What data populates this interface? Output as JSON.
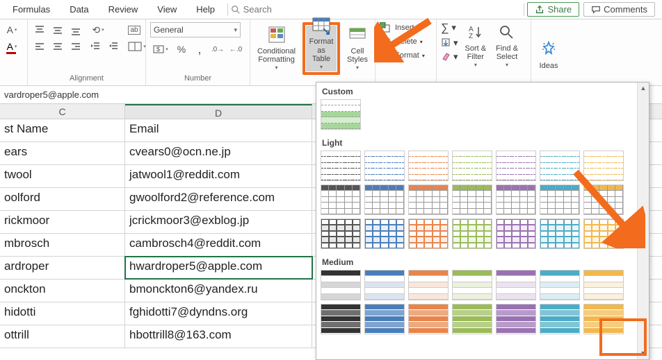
{
  "menu": {
    "tabs": [
      "Formulas",
      "Data",
      "Review",
      "View",
      "Help"
    ],
    "search_placeholder": "Search",
    "share": "Share",
    "comments": "Comments"
  },
  "ribbon": {
    "alignment_label": "Alignment",
    "number_label": "Number",
    "number_format": "General",
    "conditional": "Conditional\nFormatting",
    "format_table": "Format as\nTable",
    "cell_styles": "Cell\nStyles",
    "insert": "Insert",
    "delete": "Delete",
    "format": "Format",
    "sort_filter": "Sort &\nFilter",
    "find_select": "Find &\nSelect",
    "ideas": "Ideas"
  },
  "formula_bar": {
    "value": "vardroper5@apple.com"
  },
  "columns": {
    "C": "C",
    "D": "D"
  },
  "rows": [
    {
      "c": "st Name",
      "d": "Email"
    },
    {
      "c": "ears",
      "d": "cvears0@ocn.ne.jp"
    },
    {
      "c": "twool",
      "d": "jatwool1@reddit.com"
    },
    {
      "c": "oolford",
      "d": "gwoolford2@reference.com"
    },
    {
      "c": "rickmoor",
      "d": "jcrickmoor3@exblog.jp"
    },
    {
      "c": "mbrosch",
      "d": "cambrosch4@reddit.com"
    },
    {
      "c": "ardroper",
      "d": "hwardroper5@apple.com"
    },
    {
      "c": "onckton",
      "d": "bmonckton6@yandex.ru"
    },
    {
      "c": "hidotti",
      "d": "fghidotti7@dyndns.org"
    },
    {
      "c": "ottrill",
      "d": "hbottrill8@163.com"
    }
  ],
  "selected_row": 6,
  "dropdown": {
    "sections": [
      "Custom",
      "Light",
      "Medium"
    ],
    "light_colors": [
      "#555555",
      "#4a7ebb",
      "#e8854b",
      "#9bbb59",
      "#9a72b3",
      "#4bacc6",
      "#f2b84b"
    ],
    "medium_colors": [
      "#333333",
      "#4a7ebb",
      "#e8854b",
      "#9bbb59",
      "#9a72b3",
      "#4bacc6",
      "#f2b84b"
    ]
  }
}
